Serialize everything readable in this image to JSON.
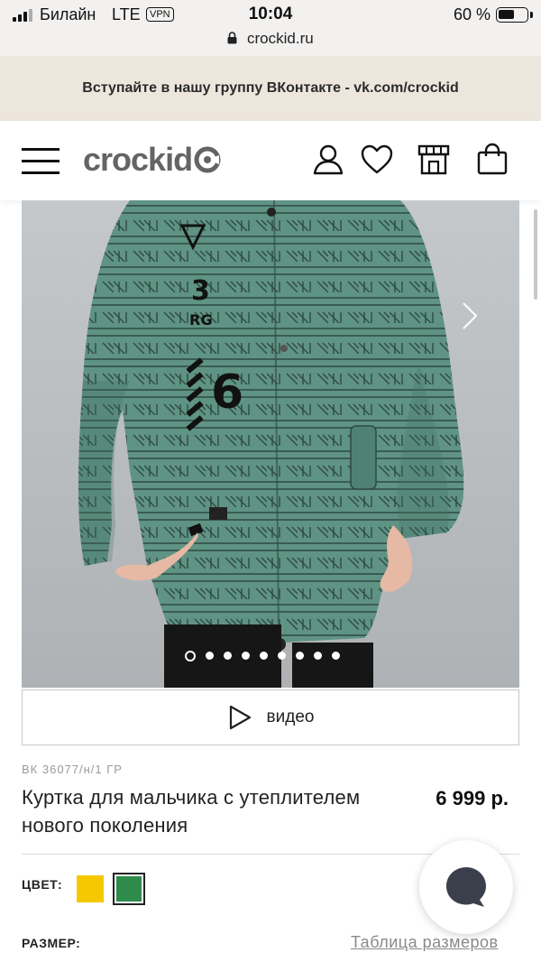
{
  "status_bar": {
    "carrier": "Билайн",
    "network": "LTE",
    "vpn": "VPN",
    "time": "10:04",
    "battery_text": "60 %",
    "battery_level": 0.6
  },
  "browser": {
    "url": "crockid.ru"
  },
  "promo_banner": {
    "text": "Вступайте в нашу группу ВКонтакте - vk.com/crockid"
  },
  "header": {
    "logo_text": "crockid",
    "icons": [
      "menu-icon",
      "user-icon",
      "heart-icon",
      "store-icon",
      "shopping-bag-icon"
    ]
  },
  "gallery": {
    "slide_count": 9,
    "active_index": 0,
    "image_description_icon": "product-photo",
    "graphic_text": [
      "3",
      "RG",
      "6"
    ]
  },
  "video": {
    "label": "видео",
    "icon": "play-icon"
  },
  "product": {
    "sku": "ВК 36077/н/1 ГР",
    "title": "Куртка для мальчика с утеплителем нового поколения",
    "price": "6 999 р."
  },
  "options": {
    "color_label": "ЦВЕТ:",
    "colors": [
      {
        "name": "yellow",
        "hex": "#f6c800",
        "selected": false
      },
      {
        "name": "green",
        "hex": "#2e8b4a",
        "selected": true
      }
    ],
    "size_label": "РАЗМЕР:",
    "size_table_link": "Таблица размеров"
  },
  "chat": {
    "icon": "chat-bubble-icon"
  }
}
